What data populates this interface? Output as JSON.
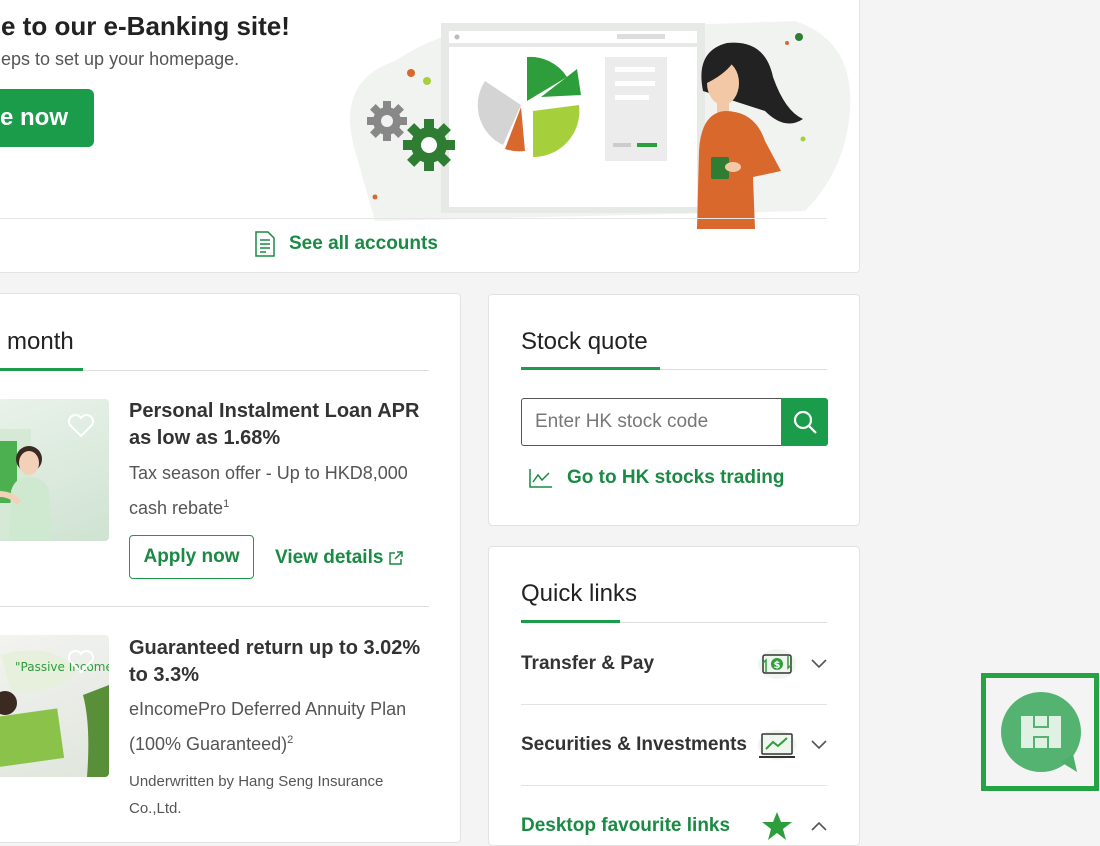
{
  "welcome": {
    "title": "e to our e-Banking site!",
    "subtitle": "eps to set up your homepage.",
    "button": "e now",
    "see_all": "See all accounts"
  },
  "promo": {
    "title": "month",
    "items": [
      {
        "title": "Personal Instalment Loan APR as low as 1.68%",
        "desc": "Tax season offer - Up to HKD8,000 cash rebate",
        "footnote": "1",
        "apply": "Apply now",
        "details": "View details"
      },
      {
        "title": "Guaranteed return up to 3.02% to 3.3%",
        "desc": "eIncomePro Deferred Annuity Plan (100% Guaranteed)",
        "footnote": "2",
        "note": "Underwritten by Hang Seng Insurance Co.,Ltd.",
        "image_text": "\"Passive Income\""
      }
    ]
  },
  "stock": {
    "title": "Stock quote",
    "placeholder": "Enter HK stock code",
    "go_trading": "Go to HK stocks trading"
  },
  "quick": {
    "title": "Quick links",
    "items": [
      {
        "label": "Transfer & Pay",
        "icon": "transfer-money-icon"
      },
      {
        "label": "Securities & Investments",
        "icon": "investment-chart-icon"
      },
      {
        "label": "Desktop favourite links",
        "icon": "star-icon"
      }
    ]
  },
  "colors": {
    "brand": "#1a9c4a",
    "text": "#333333",
    "background": "#f4f4f4"
  }
}
